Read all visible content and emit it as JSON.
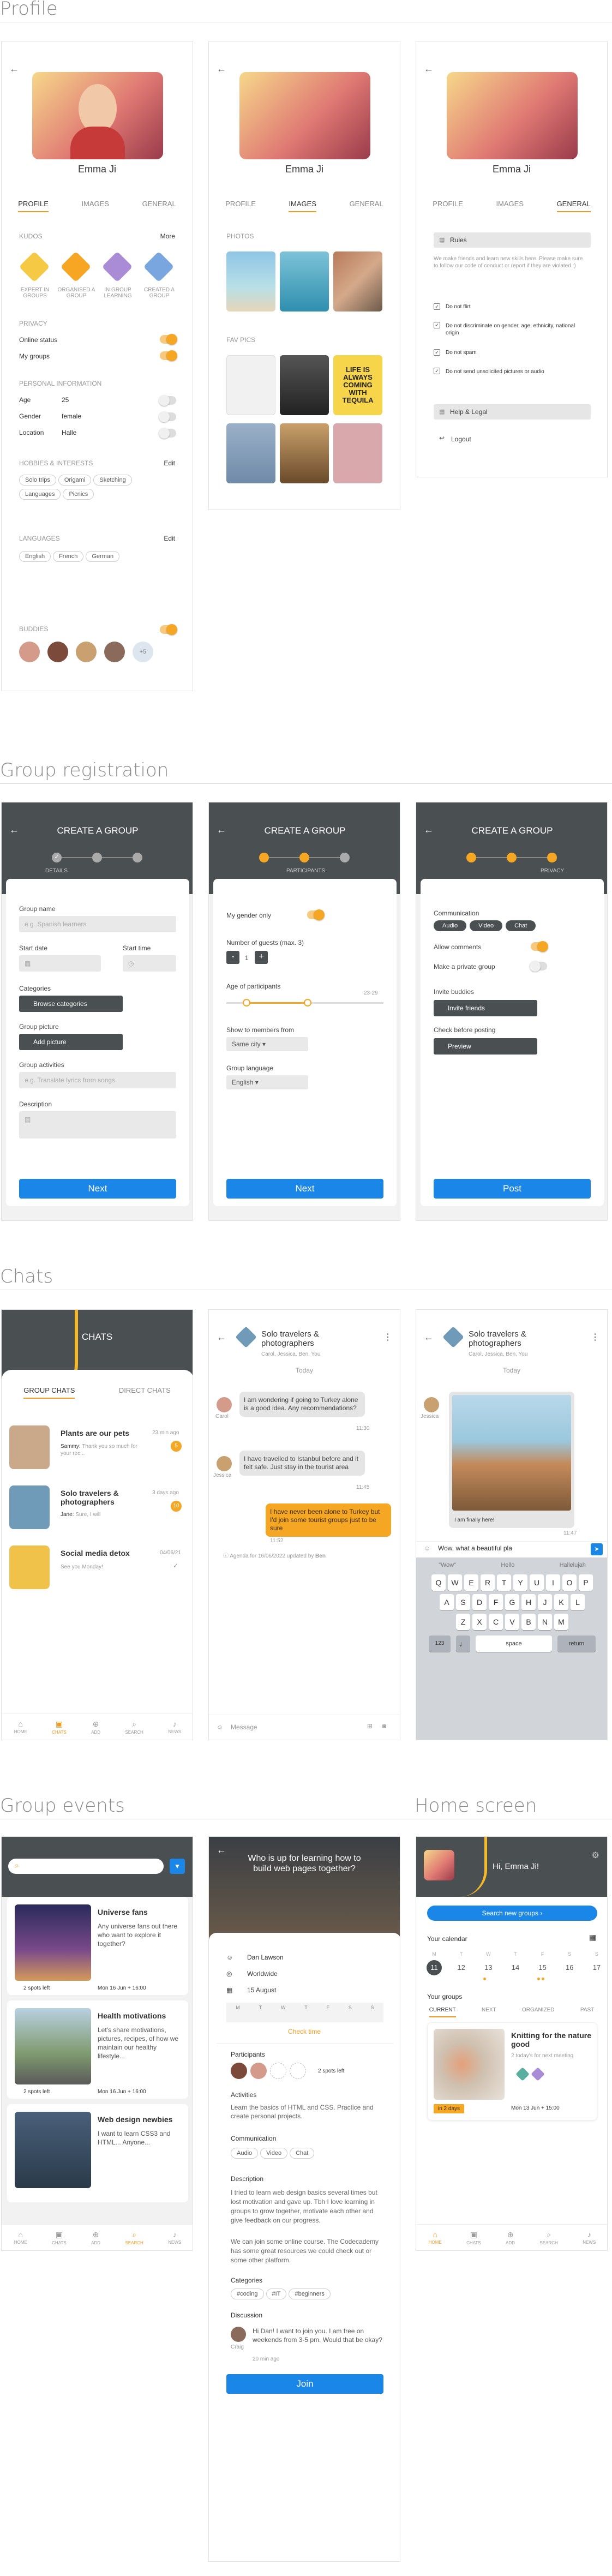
{
  "sections": {
    "profile": "Profile",
    "group_reg": "Group registration",
    "chats": "Chats",
    "group_events": "Group events",
    "home": "Home screen"
  },
  "profile": {
    "name": "Emma Ji",
    "tabs": [
      "PROFILE",
      "IMAGES",
      "GENERAL"
    ],
    "kudos_label": "KUDOS",
    "more": "More",
    "kudos": [
      {
        "label": "EXPERT IN GROUPS",
        "color": "#f6c945"
      },
      {
        "label": "ORGANISED A GROUP",
        "color": "#f6a623"
      },
      {
        "label": "IN GROUP LEARNING",
        "color": "#a98bd6"
      },
      {
        "label": "CREATED A GROUP",
        "color": "#7aa6e0"
      }
    ],
    "privacy_label": "PRIVACY",
    "online_status": "Online status",
    "my_groups": "My groups",
    "personal_label": "PERSONAL INFORMATION",
    "age_label": "Age",
    "age": "25",
    "gender_label": "Gender",
    "gender": "female",
    "location_label": "Location",
    "location": "Halle",
    "hobbies_label": "HOBBIES & INTERESTS",
    "edit": "Edit",
    "hobbies": [
      "Solo trips",
      "Origami",
      "Sketching",
      "Languages",
      "Picnics"
    ],
    "languages_label": "LANGUAGES",
    "languages": [
      "English",
      "French",
      "German"
    ],
    "buddies_label": "BUDDIES",
    "buddies_more": "+5",
    "photos_label": "PHOTOS",
    "fav_pics_label": "FAV PICS",
    "life_text": "LIFE IS ALWAYS COMING WITH TEQUILA",
    "rules_label": "Rules",
    "rules_intro": "We make friends and learn new skills here. Please make sure to follow our code of conduct or report if they are violated :)",
    "rules": [
      "Do not flirt",
      "Do not discriminate on gender, age, ethnicity, national origin",
      "Do not spam",
      "Do not send unsolicited pictures or audio"
    ],
    "help": "Help & Legal",
    "logout": "Logout"
  },
  "reg": {
    "title": "CREATE A GROUP",
    "steps": [
      "DETAILS",
      "PARTICIPANTS",
      "PRIVACY"
    ],
    "group_name": "Group name",
    "group_name_ph": "e.g. Spanish learners",
    "start_date": "Start date",
    "start_time": "Start time",
    "categories": "Categories",
    "browse": "Browse categories",
    "picture": "Group picture",
    "add_picture": "Add picture",
    "activities": "Group activities",
    "activities_ph": "e.g. Translate lyrics from songs",
    "description": "Description",
    "next": "Next",
    "gender_only": "My gender only",
    "guests": "Number of guests (max. 3)",
    "guests_val": "1",
    "minus": "-",
    "plus": "+",
    "age_label": "Age of participants",
    "age_range": "23-29",
    "show_members": "Show to members from",
    "same_city": "Same city",
    "group_language": "Group language",
    "english": "English",
    "communication": "Communication",
    "comm_options": [
      "Audio",
      "Video",
      "Chat"
    ],
    "allow_comments": "Allow comments",
    "private": "Make a private group",
    "invite_label": "Invite buddies",
    "invite_btn": "Invite friends",
    "check_label": "Check before posting",
    "preview": "Preview",
    "post": "Post"
  },
  "chats": {
    "title": "CHATS",
    "tabs": [
      "GROUP CHATS",
      "DIRECT CHATS"
    ],
    "list": [
      {
        "name": "Plants are our pets",
        "time": "23 min ago",
        "sender": "Sammy:",
        "msg": "Thank you so much for your rec...",
        "badge": "5",
        "img": "#c9a98a"
      },
      {
        "name": "Solo travelers & photographers",
        "time": "3 days ago",
        "sender": "Jane:",
        "msg": "Sure, I will",
        "badge": "10",
        "img": "#6f9bb8"
      },
      {
        "name": "Social media detox",
        "time": "04/06/21",
        "sender": "",
        "msg": "See you Monday!",
        "badge": "",
        "img": "#f0c24a"
      }
    ],
    "nav": [
      "HOME",
      "CHATS",
      "ADD",
      "SEARCH",
      "NEWS"
    ],
    "group": "Solo travelers & photographers",
    "members": "Carol, Jessica, Ben, You",
    "today": "Today",
    "msgs": [
      {
        "who": "Carol",
        "text": "I am wondering if going to Turkey alone is a good idea. Any recommendations?",
        "time": "11:30"
      },
      {
        "who": "Jessica",
        "text": "I have travelled to Istanbul before and it felt safe. Just stay in the tourist area",
        "time": "11:45"
      },
      {
        "who": "You",
        "text": "I have never been alone to Turkey but I'd join some tourist groups just to be sure",
        "time": "11:52"
      }
    ],
    "agenda": "Agenda for 16/06/2022 updated by",
    "agenda_by": "Ben",
    "message_ph": "Message",
    "img_caption": "I am finally here!",
    "img_time": "11:47",
    "typed": "Wow, what a beautiful pla",
    "suggest": [
      "\"Wow\"",
      "Hello",
      "Hallelujah"
    ],
    "rows": [
      [
        "Q",
        "W",
        "E",
        "R",
        "T",
        "Y",
        "U",
        "I",
        "O",
        "P"
      ],
      [
        "A",
        "S",
        "D",
        "F",
        "G",
        "H",
        "J",
        "K",
        "L"
      ],
      [
        "Z",
        "X",
        "C",
        "V",
        "B",
        "N",
        "M"
      ]
    ],
    "space": "space",
    "return": "return",
    "num": "123"
  },
  "events": {
    "list": [
      {
        "title": "Universe fans",
        "desc": "Any universe fans out there who want to explore it together?",
        "spots": "2 spots left",
        "date": "Mon 16 Jun + 16:00",
        "img": "#3b3a6e"
      },
      {
        "title": "Health motivations",
        "desc": "Let's share motivations, pictures, recipes, of how we maintain our healthy lifestyle...",
        "spots": "2 spots left",
        "date": "Mon 16 Jun + 16:00",
        "img": "#7f9a6f"
      },
      {
        "title": "Web design newbies",
        "desc": "I want to learn CSS3 and HTML... Anyone...",
        "spots": "",
        "date": "",
        "img": "#49607a"
      }
    ],
    "hero": "Who is up for learning how to build web pages together?",
    "host": "Dan Lawson",
    "where": "Worldwide",
    "when": "15 August",
    "days": [
      "M",
      "T",
      "W",
      "T",
      "F",
      "S",
      "S"
    ],
    "check_time": "Check time",
    "participants": "Participants",
    "spots": "2 spots left",
    "activities": "Activities",
    "activities_text": "Learn the basics of HTML and CSS. Practice and create personal projects.",
    "communication": "Communication",
    "comm": [
      "Audio",
      "Video",
      "Chat"
    ],
    "description": "Description",
    "desc_text": "I tried to learn web design basics several times but lost motivation and gave up. Tbh I love learning in groups to grow together, motivate each other and give feedback on our progress.",
    "desc_text2": "We can join some online course. The Codecademy has some great resources we could check out or some other platform.",
    "categories": "Categories",
    "tags": [
      "#coding",
      "#IT",
      "#beginners"
    ],
    "discussion": "Discussion",
    "comment_who": "Craig",
    "comment": "Hi Dan! I want to join you. I am free on weekends from 3-5 pm. Would that be okay?",
    "comment_time": "20 min ago",
    "join": "Join"
  },
  "home": {
    "greeting": "Hi, Emma Ji!",
    "search": "Search new groups",
    "calendar": "Your calendar",
    "dates": [
      "11",
      "12",
      "13",
      "14",
      "15",
      "16",
      "17"
    ],
    "days": [
      "M",
      "T",
      "W",
      "T",
      "F",
      "S",
      "S"
    ],
    "your_groups": "Your groups",
    "tabs": [
      "CURRENT",
      "NEXT",
      "ORGANIZED",
      "PAST"
    ],
    "card_title": "Knitting for the nature good",
    "card_sub": "2 today's for next meeting",
    "card_badge": "in 2 days",
    "card_date": "Mon 13 Jun + 15:00"
  }
}
